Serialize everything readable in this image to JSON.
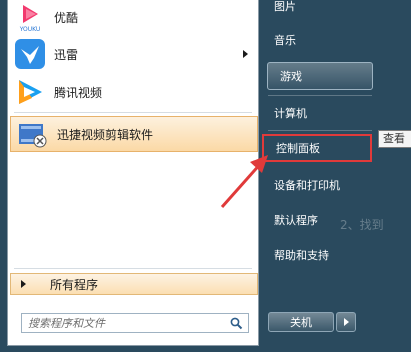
{
  "colors": {
    "right_pane_bg": "#2a4a5e",
    "highlight": "#fbd9a6",
    "annotation_red": "#e03a3a"
  },
  "programs": [
    {
      "label": "优酷",
      "icon_text": "YOUKU",
      "icon": "youku-icon"
    },
    {
      "label": "迅雷",
      "icon": "xunlei-icon",
      "has_submenu": true
    },
    {
      "label": "腾讯视频",
      "icon": "tencent-video-icon"
    },
    {
      "label": "迅捷视频剪辑软件",
      "icon": "video-editor-icon",
      "highlighted": true
    }
  ],
  "all_programs_label": "所有程序",
  "search": {
    "placeholder": "搜索程序和文件"
  },
  "right_items": [
    {
      "label": "图片"
    },
    {
      "label": "音乐"
    },
    {
      "label": "游戏"
    },
    {
      "label": "计算机"
    },
    {
      "label": "控制面板"
    },
    {
      "label": "设备和打印机"
    },
    {
      "label": "默认程序"
    },
    {
      "label": "帮助和支持"
    }
  ],
  "tooltip": "查看",
  "shutdown_label": "关机",
  "watermark": "2、找到"
}
